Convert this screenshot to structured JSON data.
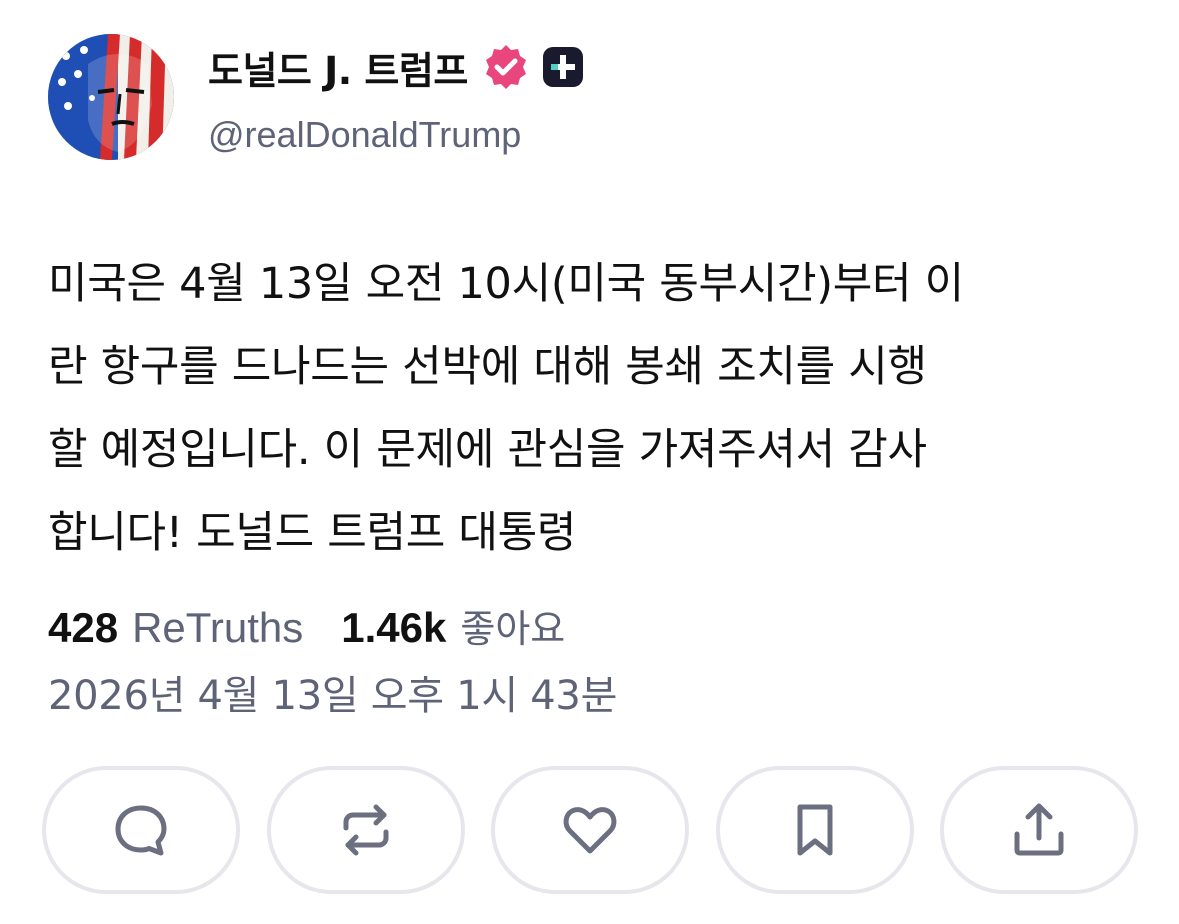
{
  "header": {
    "display_name": "도널드 J. 트럼프",
    "handle": "@realDonaldTrump",
    "verified_color": "#e8467c",
    "plus_badge_color": "#1a1a2e"
  },
  "post": {
    "lines": [
      "미국은 4월 13일 오전 10시(미국 동부시간)부터 이",
      "란 항구를 드나드는 선박에 대해 봉쇄 조치를 시행",
      "할 예정입니다. 이 문제에 관심을 가져주셔서 감사",
      "합니다! 도널드 트럼프 대통령"
    ]
  },
  "stats": {
    "retruths_count": "428",
    "retruths_label": "ReTruths",
    "likes_count": "1.46k",
    "likes_label": "좋아요"
  },
  "timestamp": "2026년 4월 13일 오후 1시 43분",
  "actions": [
    {
      "icon": "reply-icon"
    },
    {
      "icon": "retruth-icon"
    },
    {
      "icon": "like-icon"
    },
    {
      "icon": "bookmark-icon"
    },
    {
      "icon": "share-icon"
    }
  ],
  "colors": {
    "text_primary": "#111111",
    "text_secondary": "#5e6378",
    "icon": "#6b6f80",
    "button_border": "#e6e7ec"
  }
}
